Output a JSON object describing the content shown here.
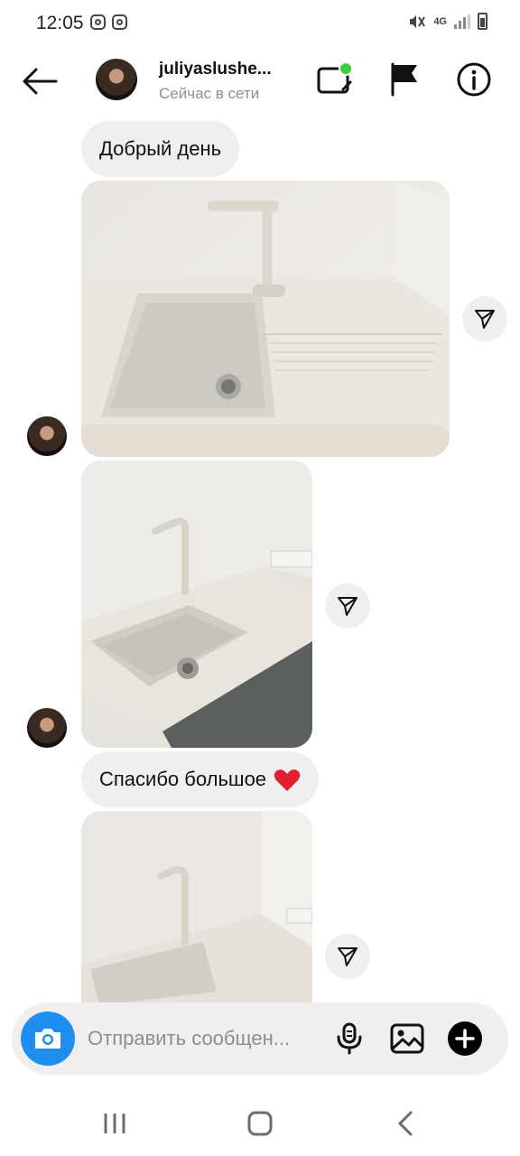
{
  "status_bar": {
    "time": "12:05",
    "network": "4G",
    "icons": [
      "instagram-notification-icon",
      "instagram-notification-icon",
      "mute-vibrate-icon",
      "signal-icon",
      "battery-icon"
    ]
  },
  "header": {
    "username": "juliyaslushe...",
    "status": "Сейчас в сети",
    "icons": [
      "back-arrow-icon",
      "video-call-icon",
      "flag-icon",
      "info-icon"
    ],
    "online_dot_color": "#3ecf3e"
  },
  "messages": [
    {
      "type": "text",
      "sender": "other",
      "text": "Добрый день"
    },
    {
      "type": "photo",
      "sender": "other",
      "description_icon": "photo"
    },
    {
      "type": "photo",
      "sender": "other",
      "description_icon": "photo"
    },
    {
      "type": "text",
      "sender": "other",
      "text": "Спасибо большое",
      "emoji": "heart"
    },
    {
      "type": "photo",
      "sender": "other",
      "description_icon": "photo"
    }
  ],
  "composer": {
    "placeholder": "Отправить сообщен...",
    "camera_color": "#1f8ef1",
    "icons": [
      "camera-icon",
      "microphone-icon",
      "gallery-icon",
      "add-icon"
    ]
  },
  "nav_bar": {
    "icons": [
      "recent-apps-icon",
      "home-icon",
      "back-icon"
    ]
  }
}
